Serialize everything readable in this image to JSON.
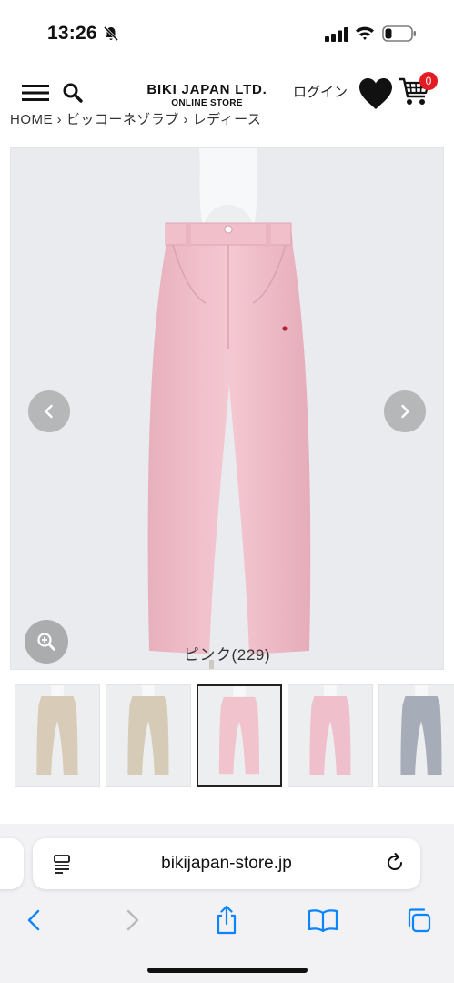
{
  "status_bar": {
    "time": "13:26",
    "icons": [
      "bell-slash-icon",
      "cellular-signal-icon",
      "wifi-icon",
      "battery-icon"
    ]
  },
  "header": {
    "brand_name": "BIKI JAPAN LTD.",
    "brand_sub": "ONLINE STORE",
    "login_label": "ログイン",
    "cart_count": "0",
    "icons": [
      "menu-icon",
      "search-icon",
      "heart-icon",
      "cart-icon"
    ]
  },
  "breadcrumb": {
    "text": "HOME › ビッコーネゾラブ › レディース"
  },
  "gallery": {
    "main_caption": "ピンク(229)",
    "selected_index": 2,
    "thumbnails": [
      {
        "color": "#d8cbb7"
      },
      {
        "color": "#d6cbb6"
      },
      {
        "color": "#f0c3cd"
      },
      {
        "color": "#efc0cb"
      },
      {
        "color": "#a7acb9"
      }
    ],
    "main_color": "#f2c4cf",
    "icons": [
      "chevron-left-icon",
      "chevron-right-icon",
      "zoom-icon"
    ]
  },
  "browser": {
    "url": "bikijapan-store.jp",
    "icons": [
      "page-menu-icon",
      "reload-icon",
      "back-icon",
      "forward-icon",
      "share-icon",
      "bookmarks-icon",
      "tabs-icon"
    ],
    "accent": "#0a84ff"
  }
}
